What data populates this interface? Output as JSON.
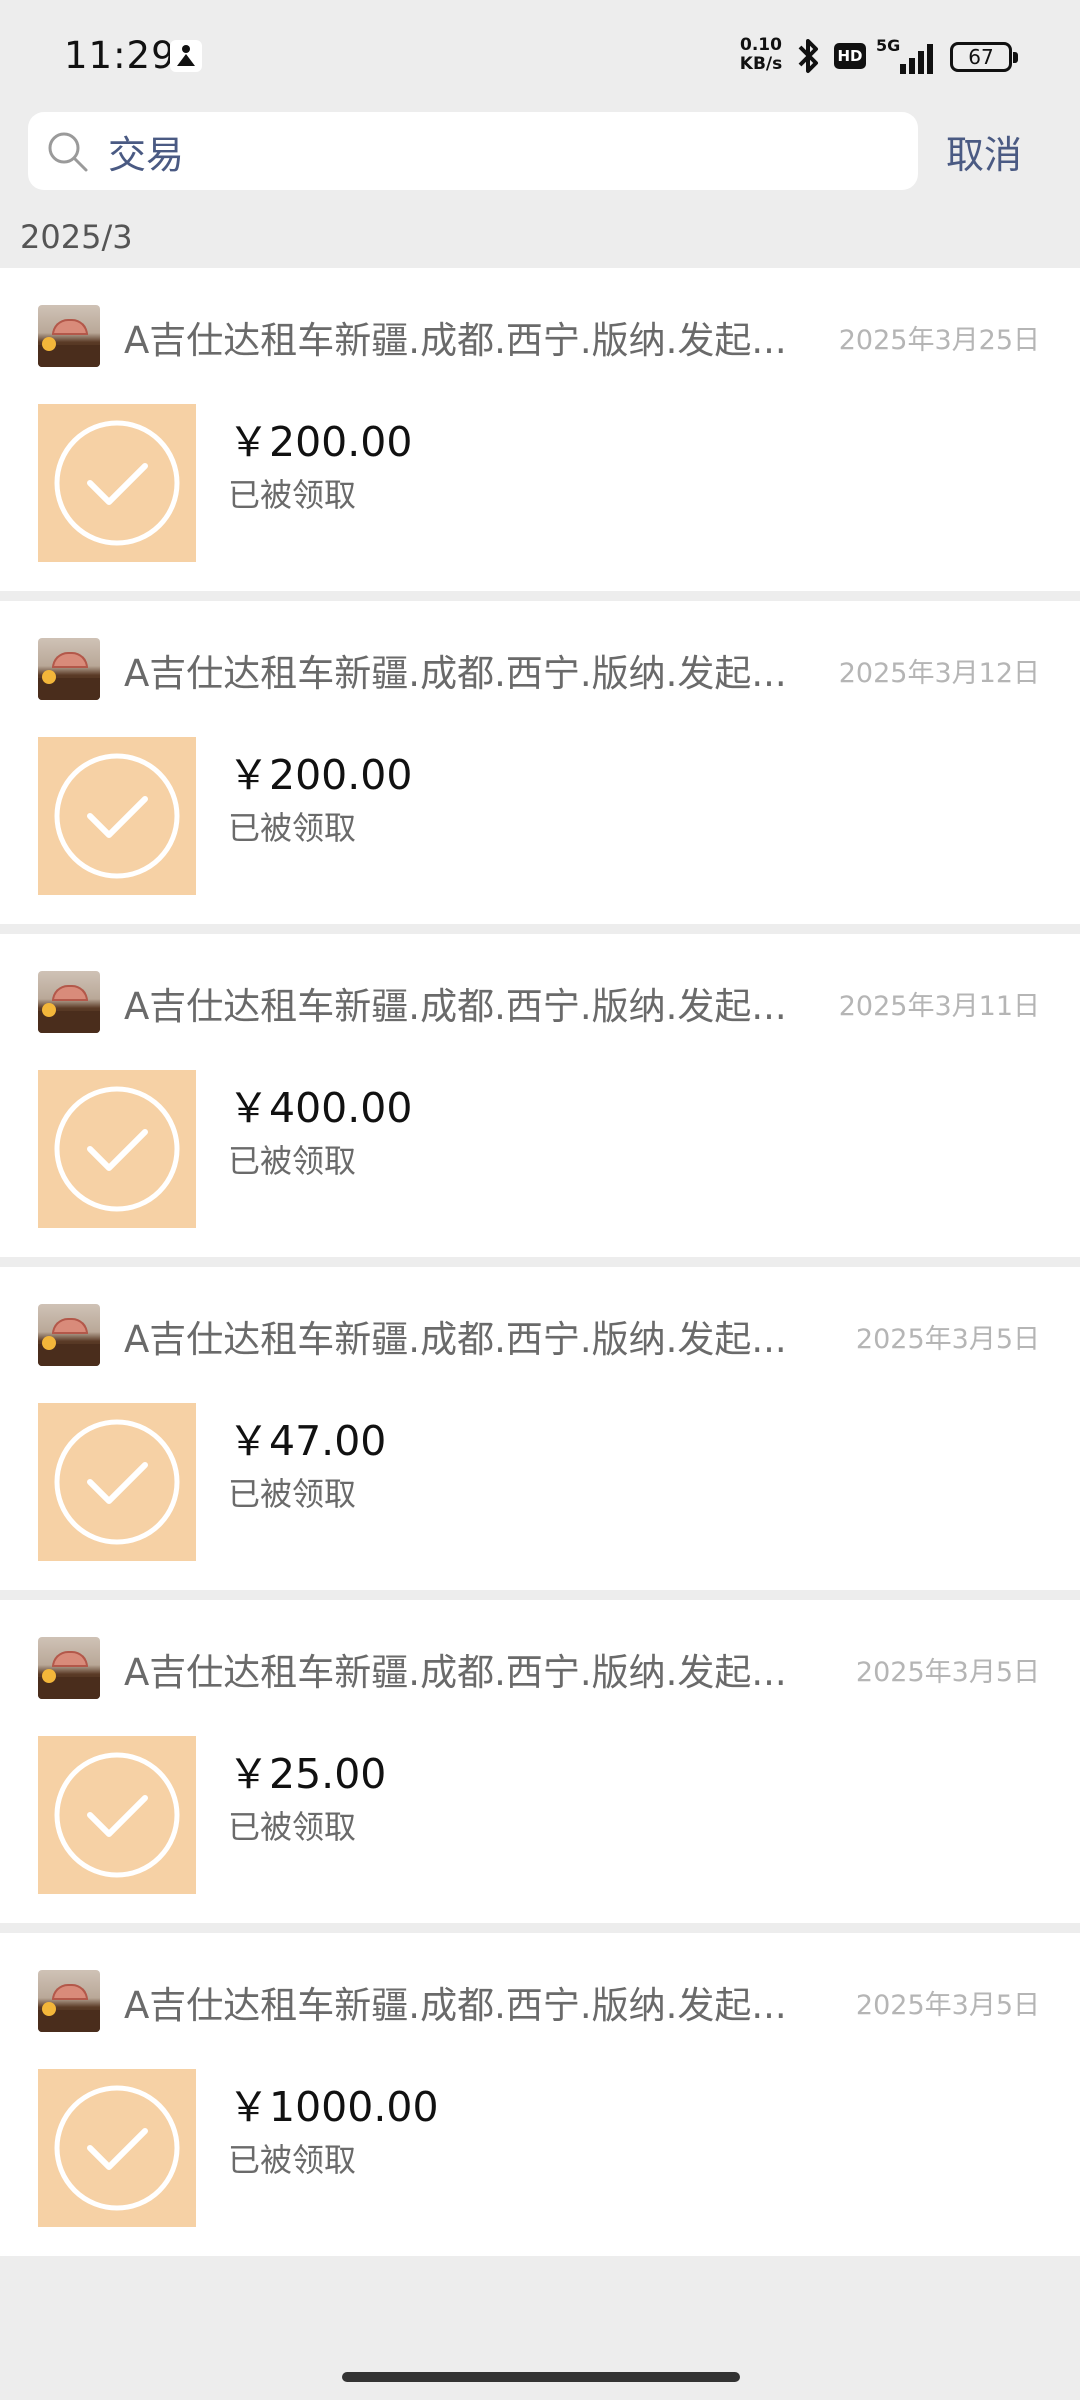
{
  "status_bar": {
    "time": "11:29",
    "net_speed_value": "0.10",
    "net_speed_unit": "KB/s",
    "hd_label": "HD",
    "signal_label": "5G",
    "battery": "67"
  },
  "search": {
    "query": "交易",
    "cancel_label": "取消"
  },
  "section": {
    "date": "2025/3"
  },
  "transactions": [
    {
      "sender": "A吉仕达租车新疆.成都.西宁.版纳.发起...",
      "date": "2025年3月25日",
      "amount": "￥200.00",
      "status": "已被领取"
    },
    {
      "sender": "A吉仕达租车新疆.成都.西宁.版纳.发起...",
      "date": "2025年3月12日",
      "amount": "￥200.00",
      "status": "已被领取"
    },
    {
      "sender": "A吉仕达租车新疆.成都.西宁.版纳.发起...",
      "date": "2025年3月11日",
      "amount": "￥400.00",
      "status": "已被领取"
    },
    {
      "sender": "A吉仕达租车新疆.成都.西宁.版纳.发起...",
      "date": "2025年3月5日",
      "amount": "￥47.00",
      "status": "已被领取"
    },
    {
      "sender": "A吉仕达租车新疆.成都.西宁.版纳.发起...",
      "date": "2025年3月5日",
      "amount": "￥25.00",
      "status": "已被领取"
    },
    {
      "sender": "A吉仕达租车新疆.成都.西宁.版纳.发起...",
      "date": "2025年3月5日",
      "amount": "￥1000.00",
      "status": "已被领取"
    }
  ],
  "colors": {
    "background": "#ededed",
    "accent_link": "#4a5a83",
    "packet_fill": "#f6d1a5"
  },
  "icons": {
    "search": "search-icon",
    "check": "check-circle-icon",
    "bluetooth": "bluetooth-icon"
  }
}
